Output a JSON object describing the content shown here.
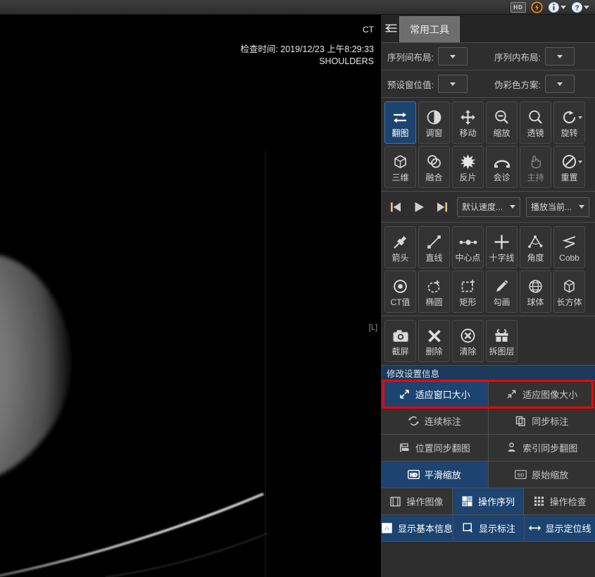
{
  "header": {
    "hd_badge": "HD",
    "icons": [
      {
        "name": "hd-badge",
        "label": "HD"
      },
      {
        "name": "lightning-icon",
        "label": ""
      },
      {
        "name": "info-icon",
        "label": ""
      },
      {
        "name": "help-icon",
        "label": ""
      }
    ]
  },
  "viewport": {
    "modality": "CT",
    "exam_time": "检查时间: 2019/12/23 上午8:29:33",
    "body_part": "SHOULDERS",
    "side_marker": "[L]"
  },
  "panel": {
    "menu_icon": "list-menu-icon",
    "tab_label": "常用工具",
    "dropdowns": [
      {
        "label": "序列间布局:",
        "value": ""
      },
      {
        "label": "序列内布局:",
        "value": ""
      },
      {
        "label": "预设窗位值:",
        "value": ""
      },
      {
        "label": "伪彩色方案:",
        "value": ""
      }
    ],
    "tools_primary": [
      {
        "label": "翻图",
        "icon": "flip-icon",
        "active": true,
        "caret": false,
        "dim": false
      },
      {
        "label": "调窗",
        "icon": "contrast-icon",
        "active": false,
        "caret": false,
        "dim": false
      },
      {
        "label": "移动",
        "icon": "pan-icon",
        "active": false,
        "caret": false,
        "dim": false
      },
      {
        "label": "缩放",
        "icon": "zoom-out-icon",
        "active": false,
        "caret": false,
        "dim": false
      },
      {
        "label": "透镜",
        "icon": "magnifier-icon",
        "active": false,
        "caret": false,
        "dim": false
      },
      {
        "label": "旋转",
        "icon": "rotate-icon",
        "active": false,
        "caret": true,
        "dim": false
      },
      {
        "label": "三维",
        "icon": "cube-3d-icon",
        "active": false,
        "caret": false,
        "dim": false
      },
      {
        "label": "融合",
        "icon": "fusion-icon",
        "active": false,
        "caret": false,
        "dim": false
      },
      {
        "label": "反片",
        "icon": "invert-icon",
        "active": false,
        "caret": false,
        "dim": false
      },
      {
        "label": "会诊",
        "icon": "phone-icon",
        "active": false,
        "caret": false,
        "dim": false
      },
      {
        "label": "主持",
        "icon": "hand-icon",
        "active": false,
        "caret": false,
        "dim": true
      },
      {
        "label": "重置",
        "icon": "reset-icon",
        "active": false,
        "caret": true,
        "dim": false
      }
    ],
    "playback": {
      "first_icon": "skip-back-icon",
      "play_icon": "play-icon",
      "last_icon": "skip-forward-icon",
      "speed_value": "默认速度...",
      "scope_value": "播放当前..."
    },
    "tools_measure": [
      {
        "label": "箭头",
        "icon": "arrow-pin-icon",
        "active": false
      },
      {
        "label": "直线",
        "icon": "line-icon",
        "active": false
      },
      {
        "label": "中心点",
        "icon": "centerpoint-icon",
        "active": false
      },
      {
        "label": "十字线",
        "icon": "crosshair-icon",
        "active": false
      },
      {
        "label": "角度",
        "icon": "angle-icon",
        "active": false
      },
      {
        "label": "Cobb",
        "icon": "cobb-angle-icon",
        "active": false
      },
      {
        "label": "CT值",
        "icon": "ct-value-icon",
        "active": false
      },
      {
        "label": "椭圆",
        "icon": "ellipse-icon",
        "active": false
      },
      {
        "label": "矩形",
        "icon": "rectangle-icon",
        "active": false
      },
      {
        "label": "勾画",
        "icon": "pencil-icon",
        "active": false
      },
      {
        "label": "球体",
        "icon": "sphere-icon",
        "active": false
      },
      {
        "label": "长方体",
        "icon": "cuboid-icon",
        "active": false
      }
    ],
    "tools_edit": [
      {
        "label": "截屏",
        "icon": "camera-icon",
        "active": false
      },
      {
        "label": "删除",
        "icon": "x-icon",
        "active": false
      },
      {
        "label": "清除",
        "icon": "clear-icon",
        "active": false
      },
      {
        "label": "拆图层",
        "icon": "split-icon",
        "active": false
      }
    ],
    "settings": {
      "section_title": "修改设置信息",
      "rows": [
        {
          "highlighted": true,
          "buttons": [
            {
              "label": "适应窗口大小",
              "icon": "fit-window-icon",
              "on": true
            },
            {
              "label": "适应图像大小",
              "icon": "fit-image-icon",
              "on": false
            }
          ]
        },
        {
          "highlighted": false,
          "buttons": [
            {
              "label": "连续标注",
              "icon": "continuous-annot-icon",
              "on": false
            },
            {
              "label": "同步标注",
              "icon": "sync-annot-icon",
              "on": false
            }
          ]
        },
        {
          "highlighted": false,
          "buttons": [
            {
              "label": "位置同步翻图",
              "icon": "position-sync-icon",
              "on": false
            },
            {
              "label": "索引同步翻图",
              "icon": "index-sync-icon",
              "on": false
            }
          ]
        },
        {
          "highlighted": false,
          "buttons": [
            {
              "label": "平滑缩放",
              "icon": "smooth-zoom-icon",
              "on": true
            },
            {
              "label": "原始缩放",
              "icon": "raw-zoom-icon",
              "on": false
            }
          ]
        },
        {
          "highlighted": false,
          "buttons": [
            {
              "label": "操作图像",
              "icon": "operate-image-icon",
              "on": false
            },
            {
              "label": "操作序列",
              "icon": "operate-series-icon",
              "on": true
            },
            {
              "label": "操作检查",
              "icon": "operate-study-icon",
              "on": false
            }
          ]
        },
        {
          "highlighted": false,
          "buttons": [
            {
              "label": "显示基本信息",
              "icon": "show-info-icon",
              "on": true
            },
            {
              "label": "显示标注",
              "icon": "show-annot-icon",
              "on": true
            },
            {
              "label": "显示定位线",
              "icon": "show-scoutline-icon",
              "on": true
            }
          ]
        }
      ]
    }
  },
  "colors": {
    "panel_bg": "#2e2e2e",
    "tool_bg": "#333333",
    "accent_blue": "#1d4370",
    "accent_border": "#3e77b4",
    "section_header": "#1c3a5b",
    "highlight_red": "#ff0000",
    "lightning_orange": "#f08a1d",
    "text": "#d2d2d2"
  }
}
